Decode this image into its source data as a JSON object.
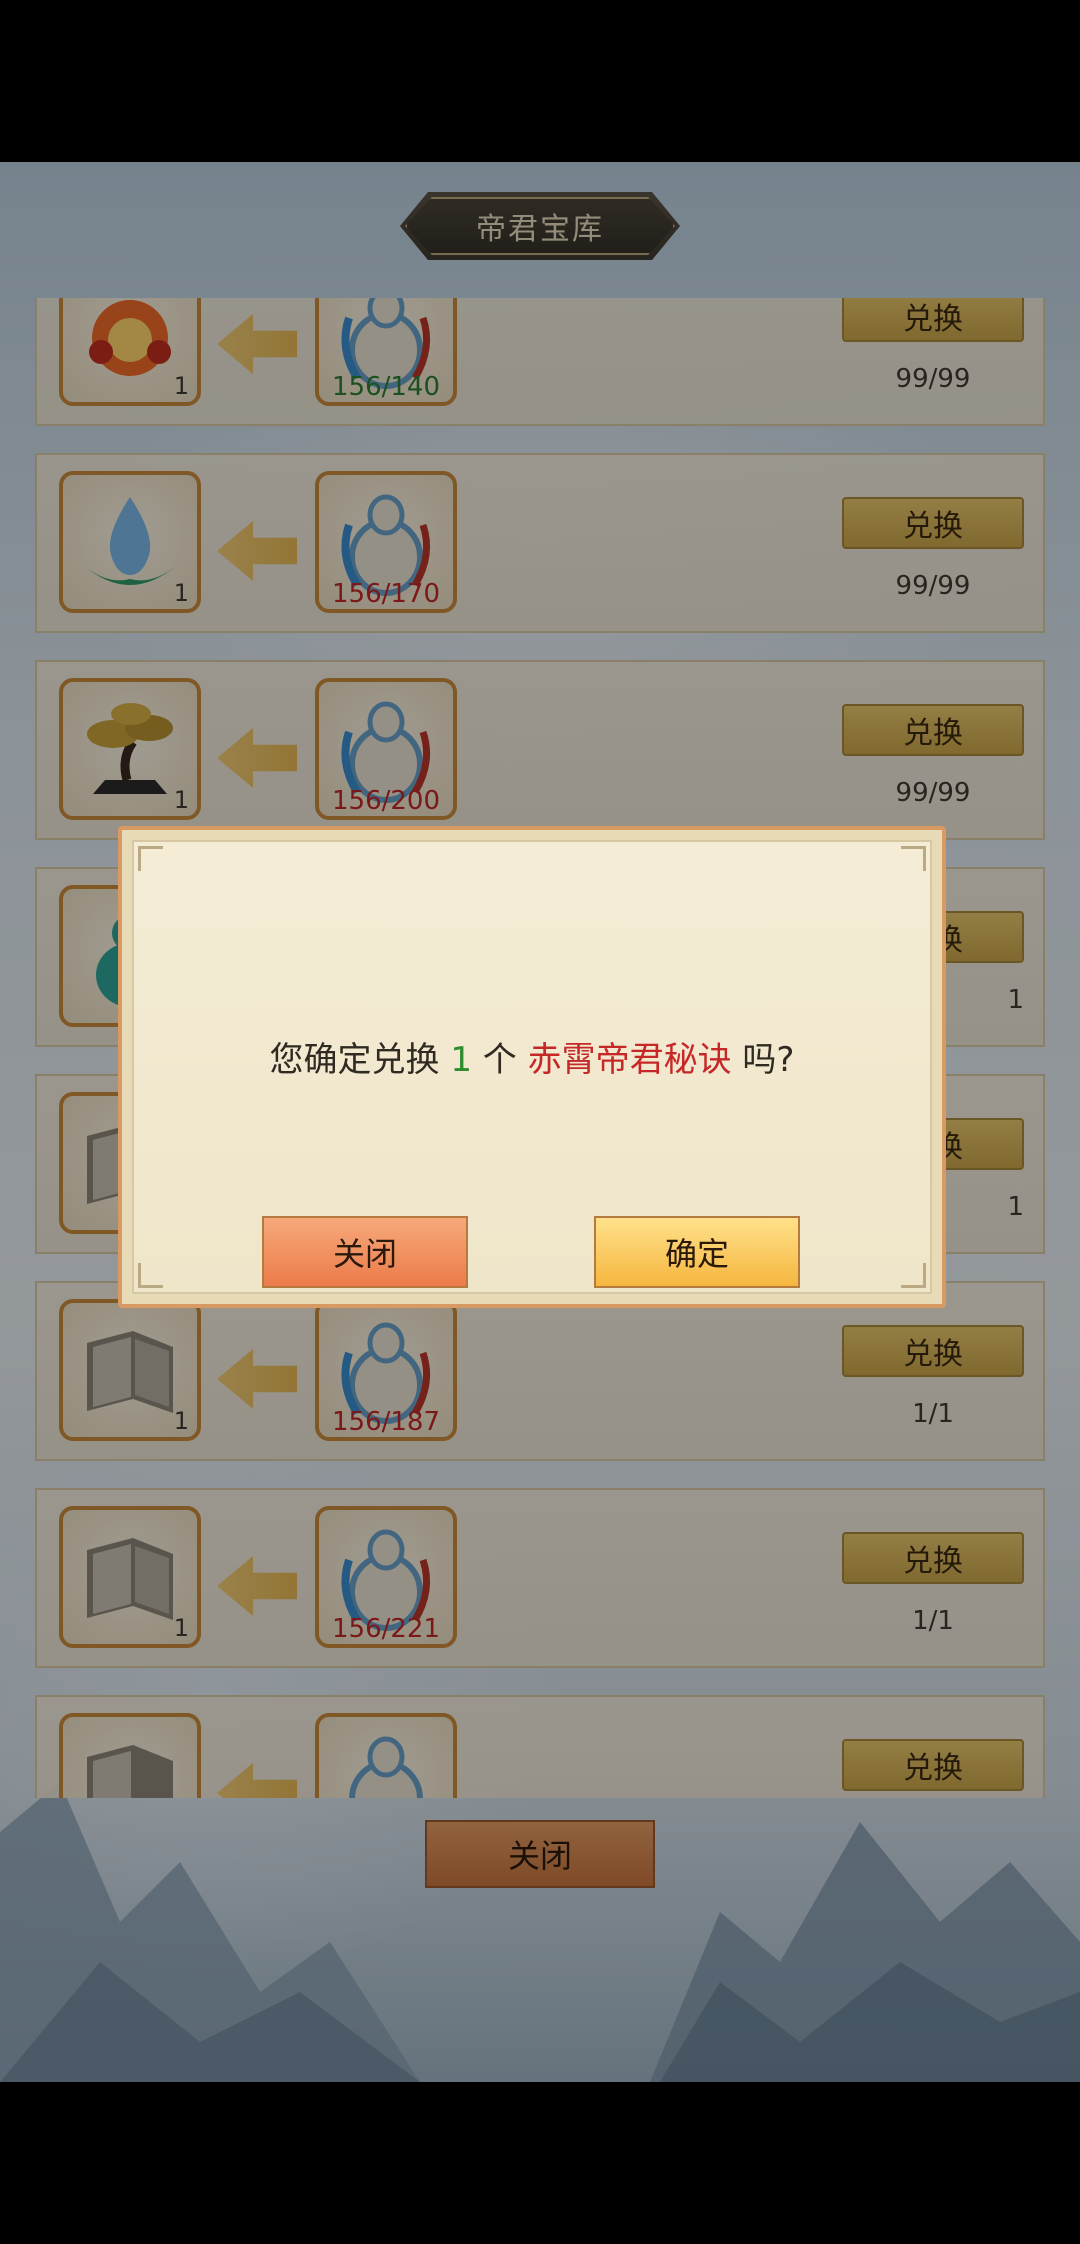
{
  "header": {
    "title": "帝君宝库"
  },
  "rows": [
    {
      "reward_icon": "fire-orb-icon",
      "reward_count": "1",
      "cost_icon": "gourd-vase-icon",
      "cost": "156/140",
      "cost_status": "green",
      "exchange_label": "兑换",
      "limit": "99/99"
    },
    {
      "reward_icon": "water-drop-leaf-icon",
      "reward_count": "1",
      "cost_icon": "gourd-vase-icon",
      "cost": "156/170",
      "cost_status": "red",
      "exchange_label": "兑换",
      "limit": "99/99"
    },
    {
      "reward_icon": "bonsai-tree-icon",
      "reward_count": "1",
      "cost_icon": "gourd-vase-icon",
      "cost": "156/200",
      "cost_status": "red",
      "exchange_label": "兑换",
      "limit": "99/99"
    },
    {
      "reward_icon": "jade-gourd-icon",
      "reward_count": "",
      "cost_icon": "gourd-vase-icon",
      "cost": "",
      "cost_status": "red",
      "exchange_label": "兑换",
      "limit": "1"
    },
    {
      "reward_icon": "scroll-book-icon",
      "reward_count": "",
      "cost_icon": "gourd-vase-icon",
      "cost": "",
      "cost_status": "red",
      "exchange_label": "兑换",
      "limit": "1"
    },
    {
      "reward_icon": "scroll-book-icon",
      "reward_count": "1",
      "cost_icon": "gourd-vase-icon",
      "cost": "156/187",
      "cost_status": "red",
      "exchange_label": "兑换",
      "limit": "1/1"
    },
    {
      "reward_icon": "scroll-book-icon",
      "reward_count": "1",
      "cost_icon": "gourd-vase-icon",
      "cost": "156/221",
      "cost_status": "red",
      "exchange_label": "兑换",
      "limit": "1/1"
    },
    {
      "reward_icon": "scroll-book-icon",
      "reward_count": "",
      "cost_icon": "gourd-vase-icon",
      "cost": "",
      "cost_status": "red",
      "exchange_label": "兑换",
      "limit": ""
    }
  ],
  "footer": {
    "close_label": "关闭"
  },
  "dialog": {
    "prefix": "您确定兑换",
    "quantity": "1",
    "unit": "个",
    "item_name": "赤霄帝君秘诀",
    "suffix": "吗?",
    "close_label": "关闭",
    "confirm_label": "确定"
  }
}
